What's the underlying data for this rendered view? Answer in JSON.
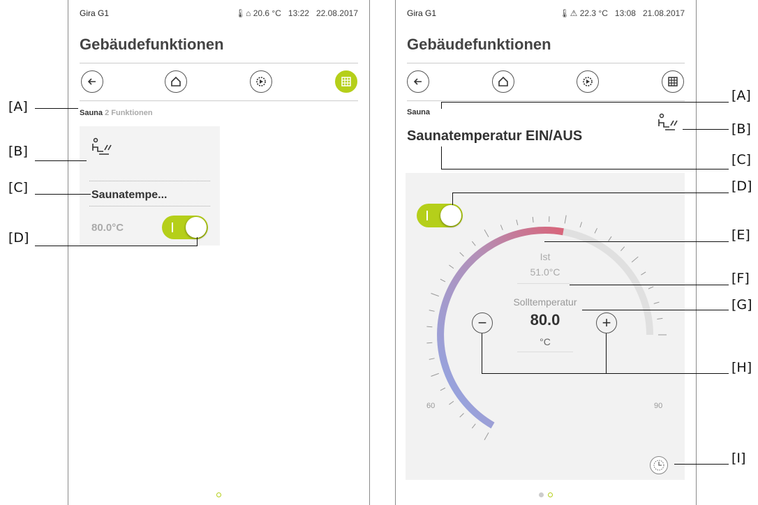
{
  "left_screen": {
    "status": {
      "app": "Gira G1",
      "temp": "20.6 °C",
      "time": "13:22",
      "date": "22.08.2017"
    },
    "title": "Gebäudefunktionen",
    "breadcrumb": {
      "room": "Sauna",
      "count": "2",
      "label": "Funktionen"
    },
    "tile": {
      "name": "Saunatempe...",
      "value": "80.0°C",
      "icon": "sauna-icon",
      "switch_on": true
    },
    "nav": {
      "active": "grid",
      "icons": [
        "back-icon",
        "home-icon",
        "settings-icon",
        "grid-icon"
      ]
    }
  },
  "right_screen": {
    "status": {
      "app": "Gira G1",
      "temp": "22.3 °C",
      "time": "13:08",
      "date": "21.08.2017"
    },
    "title": "Gebäudefunktionen",
    "breadcrumb": "Sauna",
    "function_title": "Saunatemperatur EIN/AUS",
    "dial": {
      "actual_label": "Ist",
      "actual_value": "51.0°C",
      "setpoint_label": "Solltemperatur",
      "setpoint_value": "80.0",
      "unit": "°C",
      "min": "60",
      "max": "90",
      "minus": "−",
      "plus": "+"
    },
    "switch_on": true
  },
  "annotations": {
    "left": [
      "[A]",
      "[B]",
      "[C]",
      "[D]"
    ],
    "right": [
      "[A]",
      "[B]",
      "[C]",
      "[D]",
      "[E]",
      "[F]",
      "[G]",
      "[H]",
      "[I]"
    ]
  },
  "colors": {
    "accent": "#b5cf1a",
    "dial_cold": "#8fa8e8",
    "dial_hot": "#d8657a"
  }
}
